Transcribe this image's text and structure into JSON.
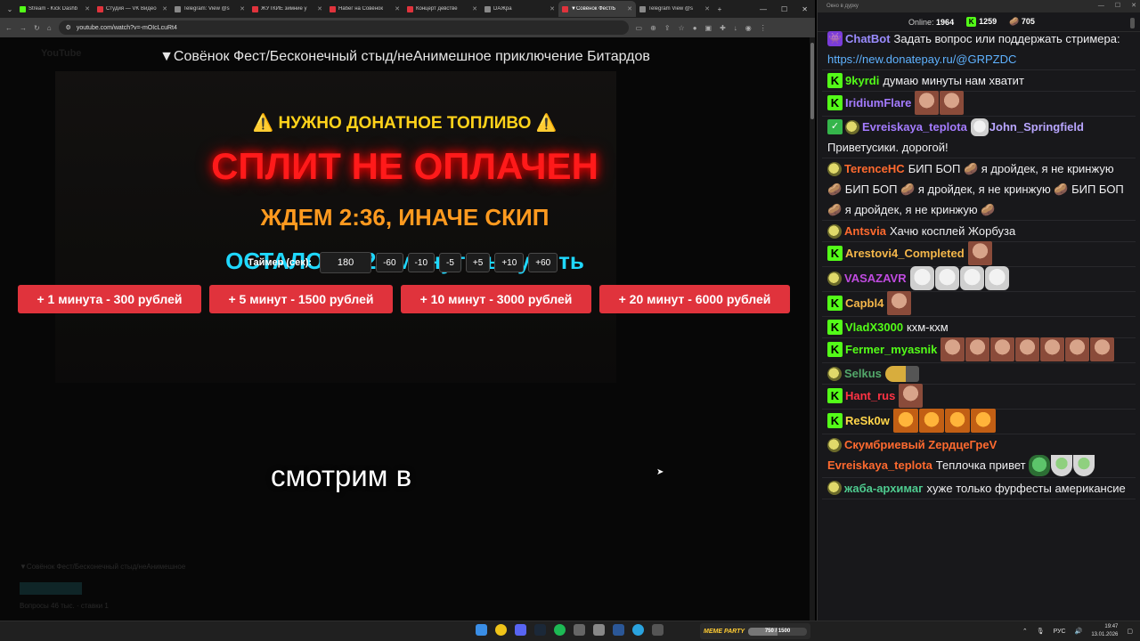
{
  "browser": {
    "tabs": [
      {
        "title": "Stream - Kick Dashb",
        "color": "#53fc18",
        "active": false
      },
      {
        "title": "Студия — VK Видео",
        "color": "#e0333c",
        "active": false
      },
      {
        "title": "Telegram: View @s",
        "color": "#888888",
        "active": false
      },
      {
        "title": "ЖУТКИЕ зимние у",
        "color": "#e0333c",
        "active": false
      },
      {
        "title": "Набег на Совёнок",
        "color": "#e0333c",
        "active": false
      },
      {
        "title": "Концерт девстве",
        "color": "#e0333c",
        "active": false
      },
      {
        "title": "DAЖра",
        "color": "#888888",
        "active": false
      },
      {
        "title": "▼Совёнок Фест/Б",
        "color": "#e0333c",
        "active": true
      },
      {
        "title": "Telegram View @s",
        "color": "#888888",
        "active": false
      }
    ],
    "new_tab": "+",
    "url": "youtube.com/watch?v=-mOIcLcuRt4"
  },
  "page": {
    "video_title": "▼Совёнок Фест/Бесконечный стыд/неАнимешное приключение Битардов",
    "logo": "YouTube",
    "warning": "⚠️ НУЖНО ДОНАТНОЕ ТОПЛИВО ⚠️",
    "split": "СПЛИТ НЕ ОПЛАЧЕН",
    "wait": "ЖДЕМ 2:36, ИНАЧЕ СКИП",
    "remain": "ОСТАЛОСЬ 27 минут выкупить",
    "timer_label": "Таймер (сек):",
    "timer_value": "180",
    "timer_buttons": [
      "-60",
      "-10",
      "-5",
      "+5",
      "+10",
      "+60"
    ],
    "donate_buttons": [
      {
        "label": "+ 1 минута - 300 рублей",
        "width": 206
      },
      {
        "label": "+ 5 минут - 1500 рублей",
        "width": 206
      },
      {
        "label": "+ 10 минут - 3000 рублей",
        "width": 214
      },
      {
        "label": "+ 20 минут - 6000 рублей",
        "width": 214
      }
    ],
    "subtitle": "смотрим в",
    "meta_line": "▼Совёнок Фест/Бесконечный стыд/неАнимешное",
    "meta_line2": "Вопросы 46 тыс. · ставки 1"
  },
  "chat": {
    "window_title": "Окно в дурку",
    "online_label": "Online:",
    "online_value": "1964",
    "kick_count": "1259",
    "pot_count": "705",
    "messages": [
      {
        "badge": "bot",
        "user": "ChatBot",
        "color": "#9b8cff",
        "text": "Задать вопрос или поддержать стримера:",
        "link": "https://new.donatepay.ru/@GRPZDC"
      },
      {
        "badge": "kick",
        "user": "9kyrdi",
        "color": "#53fc18",
        "text": "думаю минуты нам хватит"
      },
      {
        "badge": "kick",
        "user": "IridiumFlare",
        "color": "#a47bff",
        "emotes": [
          "face",
          "face"
        ]
      },
      {
        "badge": "check",
        "user": "Evreiskaya_teplota",
        "color": "#a47bff",
        "reply_to": "John_Springfield",
        "text": "Приветусики. дорогой!"
      },
      {
        "badge": "pot",
        "user": "TerenceHC",
        "color": "#ff6a2f",
        "text": "БИП БОП 🥔 я дройдек, я не кринжую 🥔 БИП БОП 🥔 я дройдек, я не кринжую 🥔 БИП БОП 🥔 я дройдек, я не кринжую 🥔"
      },
      {
        "badge": "pot",
        "user": "Antsvia",
        "color": "#ff6a2f",
        "text": "Хачю косплей Жорбуза"
      },
      {
        "badge": "kick",
        "user": "Arestovi4_Completed",
        "color": "#f5b74a",
        "emotes": [
          "face"
        ]
      },
      {
        "badge": "pot",
        "user": "VASAZAVR",
        "color": "#c04be0",
        "emotes": [
          "cat",
          "cat",
          "cat",
          "cat"
        ]
      },
      {
        "badge": "kick",
        "user": "Capbl4",
        "color": "#f5b74a",
        "emotes": [
          "face"
        ]
      },
      {
        "badge": "kick",
        "user": "VladX3000",
        "color": "#53fc18",
        "text": "кхм-кхм"
      },
      {
        "badge": "kick",
        "user": "Fermer_myasnik",
        "color": "#53fc18",
        "emotes": [
          "face",
          "face",
          "face",
          "face",
          "face",
          "face",
          "face"
        ]
      },
      {
        "badge": "pot",
        "user": "Selkus",
        "color": "#53a86a",
        "emotes": [
          "sniper"
        ]
      },
      {
        "badge": "kick",
        "user": "Hant_rus",
        "color": "#ff3344",
        "emotes": [
          "face"
        ]
      },
      {
        "badge": "kick",
        "user": "ReSk0w",
        "color": "#ffd54a",
        "emotes": [
          "tiger",
          "tiger",
          "tiger",
          "tiger"
        ]
      },
      {
        "badge": "pot",
        "user": "Скумбриевый ZердцеГреV",
        "color": "#ff6a2f",
        "second_user": "Evreiskaya_teplota",
        "second_color": "#ff6a2f",
        "text": "Теплочка привет",
        "emotes": [
          "frog",
          "bowl",
          "bowl"
        ]
      },
      {
        "badge": "pot",
        "user": "жаба-архимаг",
        "color": "#4ecb8f",
        "text": "хуже только фурфесты американсие"
      }
    ]
  },
  "taskbar": {
    "meme_title": "MEME PARTY",
    "meme_progress_text": "750 / 1500",
    "meme_progress": 0.5,
    "lang": "РУС",
    "time": "19:47",
    "date": "13.01.2026"
  }
}
